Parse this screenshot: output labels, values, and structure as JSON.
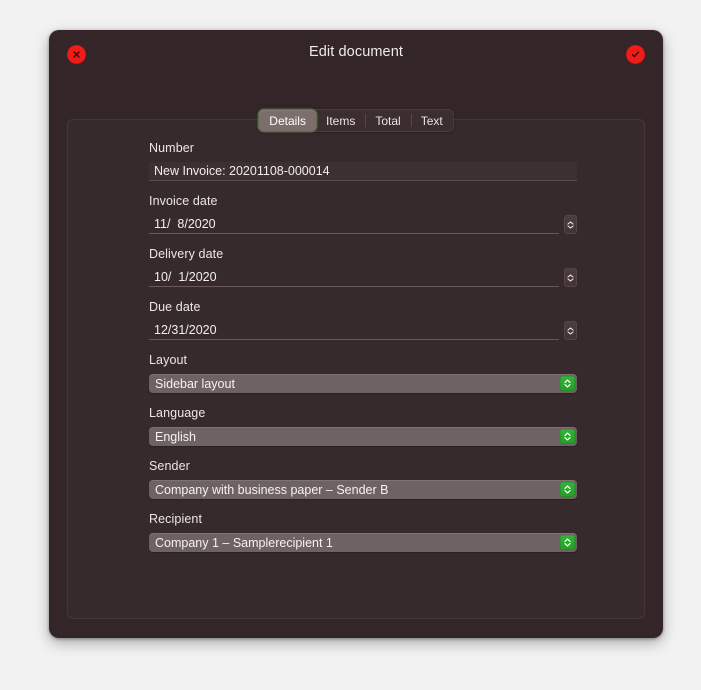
{
  "window": {
    "title": "Edit document",
    "close_button": "close",
    "confirm_button": "confirm"
  },
  "tabs": [
    {
      "label": "Details",
      "selected": true
    },
    {
      "label": "Items",
      "selected": false
    },
    {
      "label": "Total",
      "selected": false
    },
    {
      "label": "Text",
      "selected": false
    }
  ],
  "form": {
    "number": {
      "label": "Number",
      "value": "New Invoice: 20201108-000014"
    },
    "invoice_date": {
      "label": "Invoice date",
      "value": "11/  8/2020"
    },
    "delivery_date": {
      "label": "Delivery date",
      "value": "10/  1/2020"
    },
    "due_date": {
      "label": "Due date",
      "value": "12/31/2020"
    },
    "layout": {
      "label": "Layout",
      "value": "Sidebar layout"
    },
    "language": {
      "label": "Language",
      "value": "English"
    },
    "sender": {
      "label": "Sender",
      "value": "Company with business paper – Sender B"
    },
    "recipient": {
      "label": "Recipient",
      "value": "Company 1 – Samplerecipient 1"
    }
  },
  "colors": {
    "window_background": "#332528",
    "panel_background": "#362a2c",
    "page_background": "#f2f2f2",
    "close_button": "#f01c18",
    "confirm_button": "#f01c18",
    "popup_accent": "#2aa72e",
    "selected_tab_outline": "#5c6b4a",
    "text": "#f2eded"
  }
}
